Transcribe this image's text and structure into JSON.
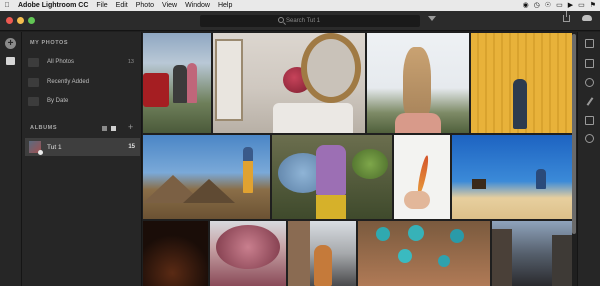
{
  "menubar": {
    "apple": "",
    "app_name": "Adobe Lightroom CC",
    "items": [
      "File",
      "Edit",
      "Photo",
      "View",
      "Window",
      "Help"
    ]
  },
  "toolbar": {
    "search_placeholder": "Search Tut 1"
  },
  "sidebar": {
    "my_photos_title": "MY PHOTOS",
    "items": [
      {
        "label": "All Photos",
        "count": "13",
        "icon": "all-photos-icon"
      },
      {
        "label": "Recently Added",
        "count": "",
        "icon": "clock-icon"
      },
      {
        "label": "By Date",
        "count": "",
        "icon": "calendar-icon"
      }
    ],
    "albums_title": "ALBUMS",
    "albums": [
      {
        "label": "Tut 1",
        "count": "15"
      }
    ]
  },
  "colors": {
    "menubar": "#e9e9e9",
    "toolbar": "#2b2b2b",
    "panel": "#262626",
    "selected": "#3e3e3e",
    "close": "#ee5a52",
    "minimize": "#f5be4f",
    "maximize": "#62c655"
  },
  "grid": {
    "photos": [
      {
        "name": "photo-red-car-couple",
        "subject": "couple by red car"
      },
      {
        "name": "photo-bathroom-roses",
        "subject": "roses in bathroom"
      },
      {
        "name": "photo-braided-hair",
        "subject": "braided hair"
      },
      {
        "name": "photo-yellow-wall-woman",
        "subject": "woman by yellow wall"
      },
      {
        "name": "photo-mountain-man",
        "subject": "man with mountains"
      },
      {
        "name": "photo-blue-flowers",
        "subject": "woman with blue flowers"
      },
      {
        "name": "photo-feather-hand",
        "subject": "feather in hand"
      },
      {
        "name": "photo-desert-blue-sky",
        "subject": "desert under blue sky"
      },
      {
        "name": "photo-dark-fire",
        "subject": "dark fire"
      },
      {
        "name": "photo-pink-tree",
        "subject": "pink blossom tree"
      },
      {
        "name": "photo-street-woman",
        "subject": "woman on street"
      },
      {
        "name": "photo-turquoise-rings",
        "subject": "turquoise rings"
      },
      {
        "name": "photo-city-evening",
        "subject": "city street evening"
      }
    ]
  }
}
